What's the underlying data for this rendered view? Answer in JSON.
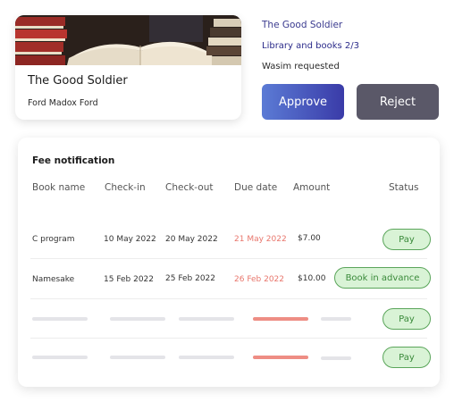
{
  "book": {
    "title": "The Good Soldier",
    "author": "Ford Madox Ford"
  },
  "request": {
    "book_title": "The Good Soldier",
    "library": "Library and books 2/3",
    "requested_by": "Wasim requested",
    "approve_label": "Approve",
    "reject_label": "Reject"
  },
  "fees": {
    "title": "Fee notification",
    "columns": [
      "Book name",
      "Check-in",
      "Check-out",
      "Due date",
      "Amount",
      "Status"
    ],
    "rows": [
      {
        "book": "C program",
        "checkin": "10 May 2022",
        "checkout": "20 May 2022",
        "due": "21 May 2022",
        "amount": "$7.00",
        "status": "Pay"
      },
      {
        "book": "Namesake",
        "checkin": "15 Feb 2022",
        "checkout": "25 Feb 2022",
        "due": "26 Feb 2022",
        "amount": "$10.00",
        "status": "Book in advance"
      },
      {
        "status": "Pay"
      },
      {
        "status": "Pay"
      }
    ]
  },
  "colors": {
    "due_date": "#e8766c",
    "approve_start": "#5b7bd5",
    "approve_end": "#3a3ba8",
    "reject": "#5a5868",
    "status_bg": "#d9f3d6",
    "status_border": "#5aa55a"
  }
}
